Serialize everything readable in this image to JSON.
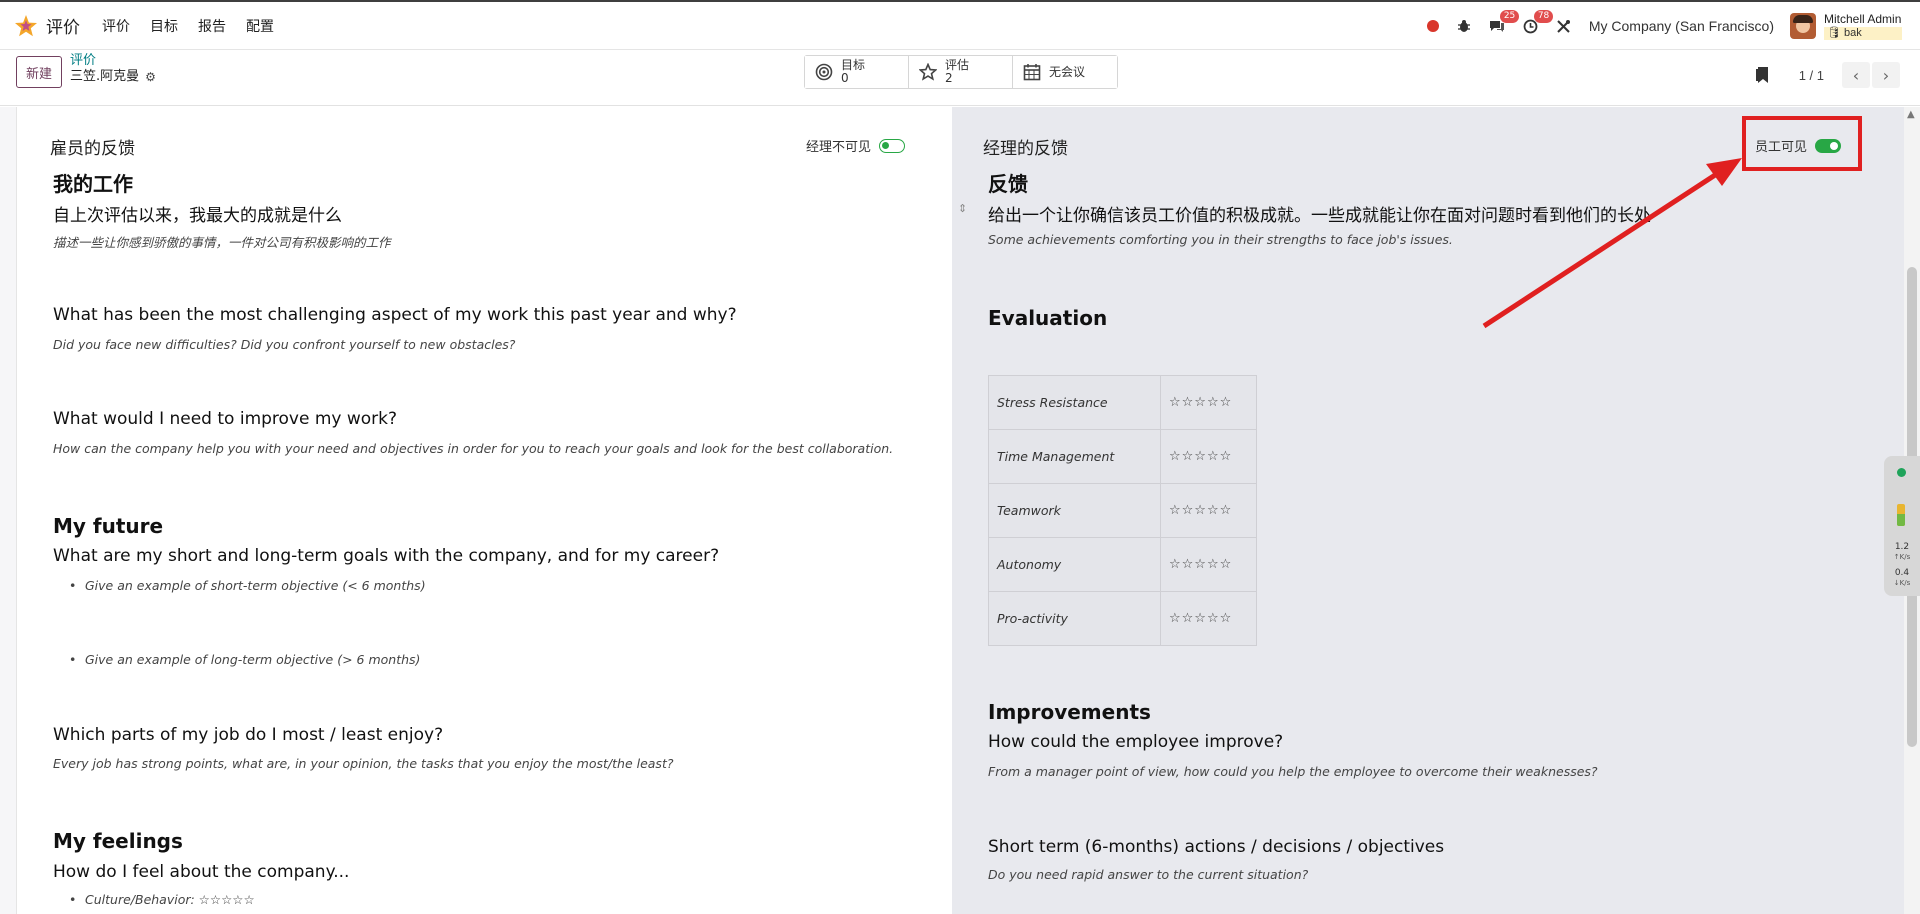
{
  "navbar": {
    "app_name": "评价",
    "menu": [
      "评价",
      "目标",
      "报告",
      "配置"
    ],
    "chat_badge": "25",
    "activity_badge": "78",
    "company": "My Company (San Francisco)",
    "user_name": "Mitchell Admin",
    "user_db": "bak"
  },
  "control": {
    "new_label": "新建",
    "breadcrumb_parent": "评价",
    "breadcrumb_current": "三笠.阿克曼",
    "smart_buttons": [
      {
        "label": "目标",
        "value": "0"
      },
      {
        "label": "评估",
        "value": "2"
      },
      {
        "label": "无会议",
        "value": ""
      }
    ],
    "pager_value": "1 / 1"
  },
  "employee": {
    "title": "雇员的反馈",
    "toggle_label": "经理不可见",
    "h_work": "我的工作",
    "q1": "自上次评估以来，我最大的成就是什么",
    "q1_hint": "描述一些让你感到骄傲的事情，一件对公司有积极影响的工作",
    "q2": "What has been the most challenging aspect of my work this past year and why?",
    "q2_hint": "Did you face new difficulties? Did you confront yourself to new obstacles?",
    "q3": "What would I need to improve my work?",
    "q3_hint": "How can the company help you with your need and objectives in order for you to reach your goals and look for the best collaboration.",
    "h_future": "My future",
    "q4": "What are my short and long-term goals with the company, and for my career?",
    "b1": "Give an example of short-term objective (< 6 months)",
    "b2": "Give an example of long-term objective (> 6 months)",
    "q5": "Which parts of my job do I most / least enjoy?",
    "q5_hint": "Every job has strong points, what are, in your opinion, the tasks that you enjoy the most/the least?",
    "h_feelings": "My feelings",
    "q6": "How do I feel about the company...",
    "b3": "Culture/Behavior: ☆☆☆☆☆"
  },
  "manager": {
    "title": "经理的反馈",
    "toggle_label": "员工可见",
    "h_feedback": "反馈",
    "q1": "给出一个让你确信该员工价值的积极成就。一些成就能让你在面对问题时看到他们的长处",
    "q1_hint": "Some achievements comforting you in their strengths to face job's issues.",
    "h_evaluation": "Evaluation",
    "eval_rows": [
      {
        "label": "Stress Resistance",
        "stars": "☆☆☆☆☆"
      },
      {
        "label": "Time Management",
        "stars": "☆☆☆☆☆"
      },
      {
        "label": "Teamwork",
        "stars": "☆☆☆☆☆"
      },
      {
        "label": "Autonomy",
        "stars": "☆☆☆☆☆"
      },
      {
        "label": "Pro-activity",
        "stars": "☆☆☆☆☆"
      }
    ],
    "h_improvements": "Improvements",
    "q2": "How could the employee improve?",
    "q2_hint": "From a manager point of view, how could you help the employee to overcome their weaknesses?",
    "q3": "Short term (6-months) actions / decisions / objectives",
    "q3_hint": "Do you need rapid answer to the current situation?"
  },
  "widget": {
    "up_value": "1.2",
    "up_unit": "K/s",
    "down_value": "0.4",
    "down_unit": "K/s"
  }
}
